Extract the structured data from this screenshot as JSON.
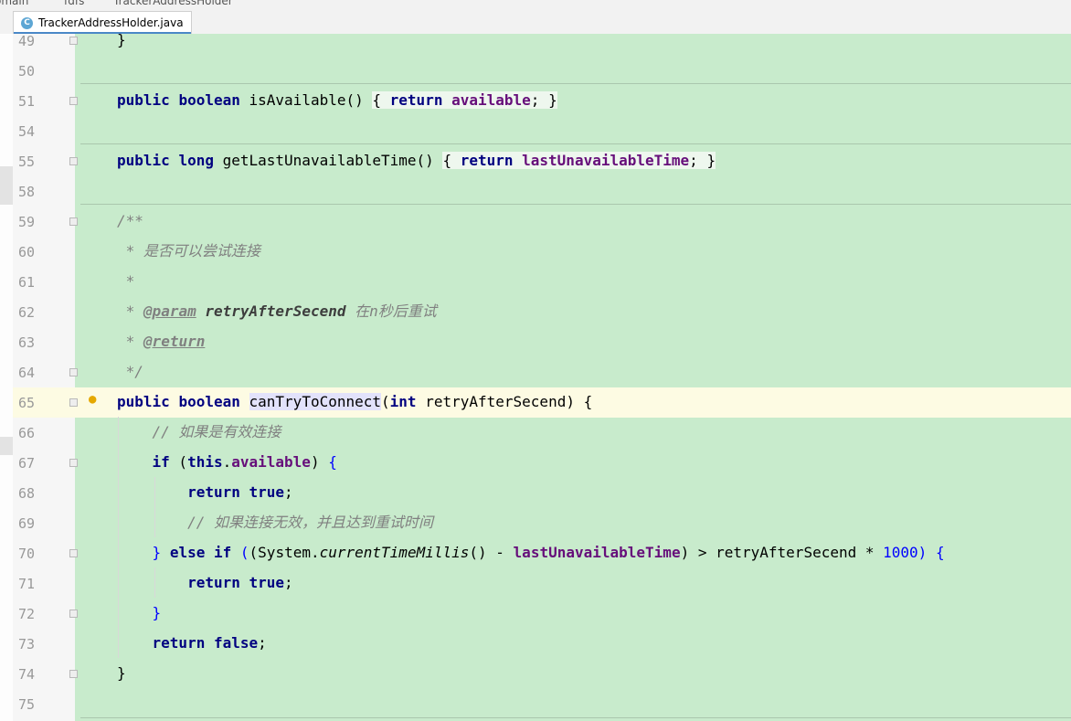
{
  "breadcrumb": [
    "omain",
    "fdfs",
    "TrackerAddressHolder"
  ],
  "tab": {
    "label": "TrackerAddressHolder.java",
    "icon": "class-icon",
    "icon_letter": "C"
  },
  "lines": [
    {
      "n": "49"
    },
    {
      "n": "50"
    },
    {
      "n": "51"
    },
    {
      "n": "54"
    },
    {
      "n": "55"
    },
    {
      "n": "58"
    },
    {
      "n": "59"
    },
    {
      "n": "60"
    },
    {
      "n": "61"
    },
    {
      "n": "62"
    },
    {
      "n": "63"
    },
    {
      "n": "64"
    },
    {
      "n": "65"
    },
    {
      "n": "66"
    },
    {
      "n": "67"
    },
    {
      "n": "68"
    },
    {
      "n": "69"
    },
    {
      "n": "70"
    },
    {
      "n": "71"
    },
    {
      "n": "72"
    },
    {
      "n": "73"
    },
    {
      "n": "74"
    },
    {
      "n": "75"
    }
  ],
  "code": {
    "close_brace": "}",
    "public": "public",
    "boolean": "boolean",
    "long": "long",
    "int": "int",
    "return": "return",
    "is_available": "isAvailable()",
    "available": "available",
    "get_last": "getLastUnavailableTime()",
    "last_unavailable_time": "lastUnavailableTime",
    "doc_open": "/**",
    "doc_desc": "是否可以尝试连接",
    "doc_star": "*",
    "doc_param_tag": "@param",
    "doc_param_name": "retryAfterSecend",
    "doc_param_desc": "在n秒后重试",
    "doc_return_tag": "@return",
    "doc_close": "*/",
    "method_name": "canTryToConnect",
    "param_name": "retryAfterSecend",
    "comment_valid": "// 如果是有效连接",
    "if": "if",
    "this": "this",
    "true": "true",
    "false": "false",
    "comment_invalid": "// 如果连接无效，并且达到重试时间",
    "else": "else",
    "system": "System",
    "current_time": "currentTimeMillis",
    "thousand": "1000"
  },
  "colors": {
    "editor_bg": "#c8ebcc",
    "keyword": "#000080",
    "field": "#660e7a",
    "number": "#0000ff",
    "comment": "#808080",
    "current_line": "#fdfbe3"
  }
}
